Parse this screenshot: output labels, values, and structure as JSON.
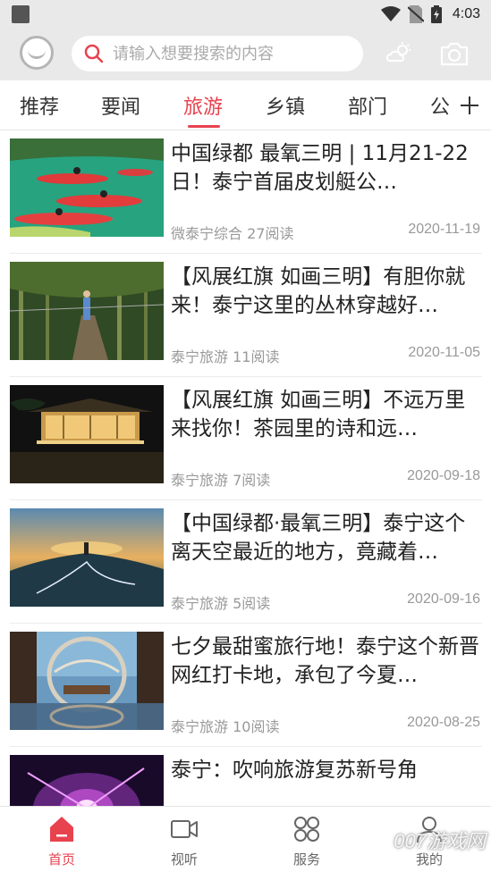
{
  "status_bar": {
    "time": "4:03"
  },
  "search": {
    "placeholder": "请输入想要搜索的内容"
  },
  "tabs": [
    {
      "label": "推荐"
    },
    {
      "label": "要闻"
    },
    {
      "label": "旅游"
    },
    {
      "label": "乡镇"
    },
    {
      "label": "部门"
    },
    {
      "label": "公"
    }
  ],
  "active_tab": "旅游",
  "news": [
    {
      "title": "中国绿都 最氧三明 | 11月21-22日！泰宁首届皮划艇公…",
      "source": "微泰宁综合 27阅读",
      "date": "2020-11-19",
      "image": "kayak-race"
    },
    {
      "title": "【风展红旗 如画三明】有胆你就来！泰宁这里的丛林穿越好…",
      "source": "泰宁旅游 11阅读",
      "date": "2020-11-05",
      "image": "forest-zipline"
    },
    {
      "title": "【风展红旗 如画三明】不远万里来找你！茶园里的诗和远…",
      "source": "泰宁旅游 7阅读",
      "date": "2020-09-18",
      "image": "tea-house-night"
    },
    {
      "title": "【中国绿都·最氧三明】泰宁这个离天空最近的地方，竟藏着…",
      "source": "泰宁旅游 5阅读",
      "date": "2020-09-16",
      "image": "mountain-road-sunset"
    },
    {
      "title": "七夕最甜蜜旅行地！泰宁这个新晋网红打卡地，承包了今夏…",
      "source": "泰宁旅游 10阅读",
      "date": "2020-08-25",
      "image": "lakeside-gazebo"
    },
    {
      "title": "泰宁：吹响旅游复苏新号角",
      "source": "",
      "date": "",
      "image": "night-light-show"
    }
  ],
  "bottom_nav": [
    {
      "label": "首页",
      "icon": "home-icon"
    },
    {
      "label": "视听",
      "icon": "video-icon"
    },
    {
      "label": "服务",
      "icon": "services-grid-icon"
    },
    {
      "label": "我的",
      "icon": "user-icon"
    }
  ],
  "watermark": "007游戏网",
  "colors": {
    "accent": "#e8424f",
    "header_bg": "#e9e9e9",
    "text_secondary": "#999999"
  }
}
